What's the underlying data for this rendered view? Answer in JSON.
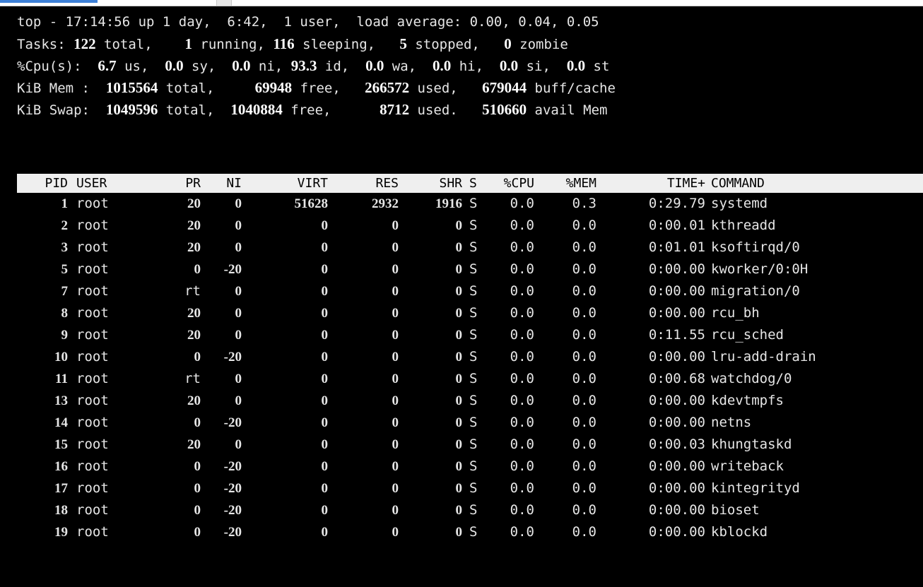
{
  "summary": {
    "uptime": "top - 17:14:56 up 1 day,  6:42,  1 user,  load average: 0.00, 0.04, 0.05",
    "tasks": {
      "label": "Tasks:",
      "total": "122",
      "total_lbl": " total,",
      "running": "1",
      "running_lbl": " running,",
      "sleeping": "116",
      "sleeping_lbl": " sleeping,",
      "stopped": "5",
      "stopped_lbl": " stopped,",
      "zombie": "0",
      "zombie_lbl": " zombie"
    },
    "cpu": {
      "label": "%Cpu(s):",
      "us": "6.7",
      "us_lbl": " us,",
      "sy": "0.0",
      "sy_lbl": " sy,",
      "ni": "0.0",
      "ni_lbl": " ni,",
      "id": "93.3",
      "id_lbl": " id,",
      "wa": "0.0",
      "wa_lbl": " wa,",
      "hi": "0.0",
      "hi_lbl": " hi,",
      "si": "0.0",
      "si_lbl": " si,",
      "st": "0.0",
      "st_lbl": " st"
    },
    "mem": {
      "label": "KiB Mem :",
      "total": "1015564",
      "total_lbl": " total,",
      "free": "69948",
      "free_lbl": " free,",
      "used": "266572",
      "used_lbl": " used,",
      "buff": "679044",
      "buff_lbl": " buff/cache"
    },
    "swap": {
      "label": "KiB Swap:",
      "total": "1049596",
      "total_lbl": " total,",
      "free": "1040884",
      "free_lbl": " free,",
      "used": "8712",
      "used_lbl": " used.",
      "avail": "510660",
      "avail_lbl": " avail Mem"
    }
  },
  "columns": {
    "pid": "PID",
    "user": "USER",
    "pr": "PR",
    "ni": "NI",
    "virt": "VIRT",
    "res": "RES",
    "shr": "SHR",
    "s": "S",
    "cpu": "%CPU",
    "mem": "%MEM",
    "time": "TIME+",
    "command": "COMMAND"
  },
  "processes": [
    {
      "pid": "1",
      "user": "root",
      "pr": "20",
      "ni": "0",
      "virt": "51628",
      "res": "2932",
      "shr": "1916",
      "s": "S",
      "cpu": "0.0",
      "mem": "0.3",
      "time": "0:29.79",
      "command": "systemd"
    },
    {
      "pid": "2",
      "user": "root",
      "pr": "20",
      "ni": "0",
      "virt": "0",
      "res": "0",
      "shr": "0",
      "s": "S",
      "cpu": "0.0",
      "mem": "0.0",
      "time": "0:00.01",
      "command": "kthreadd"
    },
    {
      "pid": "3",
      "user": "root",
      "pr": "20",
      "ni": "0",
      "virt": "0",
      "res": "0",
      "shr": "0",
      "s": "S",
      "cpu": "0.0",
      "mem": "0.0",
      "time": "0:01.01",
      "command": "ksoftirqd/0"
    },
    {
      "pid": "5",
      "user": "root",
      "pr": "0",
      "ni": "-20",
      "virt": "0",
      "res": "0",
      "shr": "0",
      "s": "S",
      "cpu": "0.0",
      "mem": "0.0",
      "time": "0:00.00",
      "command": "kworker/0:0H"
    },
    {
      "pid": "7",
      "user": "root",
      "pr": "rt",
      "ni": "0",
      "virt": "0",
      "res": "0",
      "shr": "0",
      "s": "S",
      "cpu": "0.0",
      "mem": "0.0",
      "time": "0:00.00",
      "command": "migration/0"
    },
    {
      "pid": "8",
      "user": "root",
      "pr": "20",
      "ni": "0",
      "virt": "0",
      "res": "0",
      "shr": "0",
      "s": "S",
      "cpu": "0.0",
      "mem": "0.0",
      "time": "0:00.00",
      "command": "rcu_bh"
    },
    {
      "pid": "9",
      "user": "root",
      "pr": "20",
      "ni": "0",
      "virt": "0",
      "res": "0",
      "shr": "0",
      "s": "S",
      "cpu": "0.0",
      "mem": "0.0",
      "time": "0:11.55",
      "command": "rcu_sched"
    },
    {
      "pid": "10",
      "user": "root",
      "pr": "0",
      "ni": "-20",
      "virt": "0",
      "res": "0",
      "shr": "0",
      "s": "S",
      "cpu": "0.0",
      "mem": "0.0",
      "time": "0:00.00",
      "command": "lru-add-drain"
    },
    {
      "pid": "11",
      "user": "root",
      "pr": "rt",
      "ni": "0",
      "virt": "0",
      "res": "0",
      "shr": "0",
      "s": "S",
      "cpu": "0.0",
      "mem": "0.0",
      "time": "0:00.68",
      "command": "watchdog/0"
    },
    {
      "pid": "13",
      "user": "root",
      "pr": "20",
      "ni": "0",
      "virt": "0",
      "res": "0",
      "shr": "0",
      "s": "S",
      "cpu": "0.0",
      "mem": "0.0",
      "time": "0:00.00",
      "command": "kdevtmpfs"
    },
    {
      "pid": "14",
      "user": "root",
      "pr": "0",
      "ni": "-20",
      "virt": "0",
      "res": "0",
      "shr": "0",
      "s": "S",
      "cpu": "0.0",
      "mem": "0.0",
      "time": "0:00.00",
      "command": "netns"
    },
    {
      "pid": "15",
      "user": "root",
      "pr": "20",
      "ni": "0",
      "virt": "0",
      "res": "0",
      "shr": "0",
      "s": "S",
      "cpu": "0.0",
      "mem": "0.0",
      "time": "0:00.03",
      "command": "khungtaskd"
    },
    {
      "pid": "16",
      "user": "root",
      "pr": "0",
      "ni": "-20",
      "virt": "0",
      "res": "0",
      "shr": "0",
      "s": "S",
      "cpu": "0.0",
      "mem": "0.0",
      "time": "0:00.00",
      "command": "writeback"
    },
    {
      "pid": "17",
      "user": "root",
      "pr": "0",
      "ni": "-20",
      "virt": "0",
      "res": "0",
      "shr": "0",
      "s": "S",
      "cpu": "0.0",
      "mem": "0.0",
      "time": "0:00.00",
      "command": "kintegrityd"
    },
    {
      "pid": "18",
      "user": "root",
      "pr": "0",
      "ni": "-20",
      "virt": "0",
      "res": "0",
      "shr": "0",
      "s": "S",
      "cpu": "0.0",
      "mem": "0.0",
      "time": "0:00.00",
      "command": "bioset"
    },
    {
      "pid": "19",
      "user": "root",
      "pr": "0",
      "ni": "-20",
      "virt": "0",
      "res": "0",
      "shr": "0",
      "s": "S",
      "cpu": "0.0",
      "mem": "0.0",
      "time": "0:00.00",
      "command": "kblockd"
    }
  ]
}
